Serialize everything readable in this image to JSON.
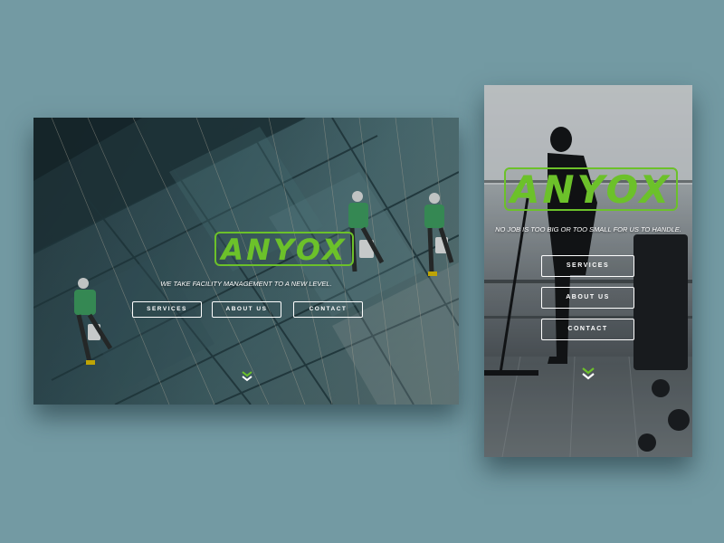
{
  "brand": {
    "logo_text": "ANYOX",
    "accent_color": "#6cc12a"
  },
  "desktop": {
    "tagline": "WE TAKE FACILITY MANAGEMENT TO A NEW LEVEL.",
    "buttons": [
      {
        "label": "SERVICES"
      },
      {
        "label": "ABOUT US"
      },
      {
        "label": "CONTACT"
      }
    ],
    "scroll_icon": "chevron-down-double-icon"
  },
  "mobile": {
    "tagline": "NO JOB IS TOO BIG OR TOO SMALL FOR US TO HANDLE.",
    "buttons": [
      {
        "label": "SERVICES"
      },
      {
        "label": "ABOUT US"
      },
      {
        "label": "CONTACT"
      }
    ],
    "scroll_icon": "chevron-down-double-icon"
  }
}
